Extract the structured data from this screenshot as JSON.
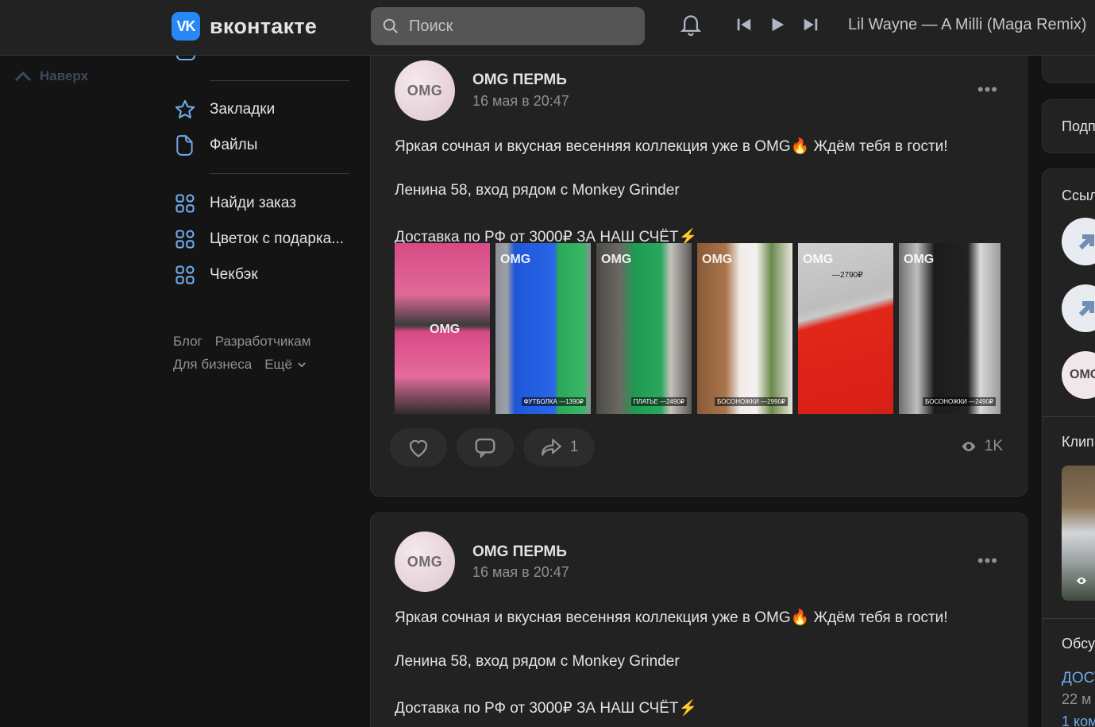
{
  "header": {
    "logo_mark": "VK",
    "logo_text": "вконтакте",
    "search_placeholder": "Поиск",
    "now_playing": "Lil Wayne — A Milli (Maga Remix)",
    "accent": "#2787f5"
  },
  "to_top": {
    "label": "Наверх"
  },
  "nav": {
    "items": [
      {
        "label": "Закладки",
        "icon": "star-icon"
      },
      {
        "label": "Файлы",
        "icon": "file-icon"
      },
      {
        "label": "Найди заказ",
        "icon": "apps-icon"
      },
      {
        "label": "Цветок с подарка...",
        "icon": "apps-icon"
      },
      {
        "label": "Чекбэк",
        "icon": "apps-icon"
      }
    ],
    "footer": [
      "Блог",
      "Разработчикам",
      "Для бизнеса",
      "Ещё"
    ]
  },
  "posts": [
    {
      "avatar_text": "OMG",
      "author": "OMG ПЕРМЬ",
      "date": "16 мая в 20:47",
      "line1": "Яркая сочная и вкусная весенняя коллекция уже в OMG🔥 Ждём тебя в гости!",
      "line2": "Ленина 58, вход рядом с Monkey Grinder",
      "line3": "Доставка по РФ от 3000₽ ЗА НАШ СЧЁТ⚡",
      "photos": [
        {
          "watermark": "OMG",
          "price": ""
        },
        {
          "watermark": "OMG",
          "price": "ФУТБОЛКА —1390₽"
        },
        {
          "watermark": "OMG",
          "price": "ПЛАТЬЕ —2490₽"
        },
        {
          "watermark": "OMG",
          "price": "БОСОНОЖКИ —2990₽"
        },
        {
          "watermark": "OMG",
          "price": "—2790₽"
        },
        {
          "watermark": "OMG",
          "price": "БОСОНОЖКИ —2490₽"
        }
      ],
      "likes": "",
      "reposts": "1",
      "views": "1K"
    },
    {
      "avatar_text": "OMG",
      "author": "OMG ПЕРМЬ",
      "date": "16 мая в 20:47",
      "line1": "Яркая сочная и вкусная весенняя коллекция уже в OMG🔥 Ждём тебя в гости!",
      "line2": "Ленина 58, вход рядом с Monkey Grinder",
      "line3": "Доставка по РФ от 3000₽ ЗА НАШ СЧЁТ⚡"
    }
  ],
  "right": {
    "sections": [
      "Подп",
      "Ссыл",
      "Клип",
      "Обсу"
    ],
    "link_avatar_text": "OMG",
    "discussion_title": "ДОСТ",
    "discussion_date": "22 м",
    "discussion_comments": "1 ком"
  }
}
